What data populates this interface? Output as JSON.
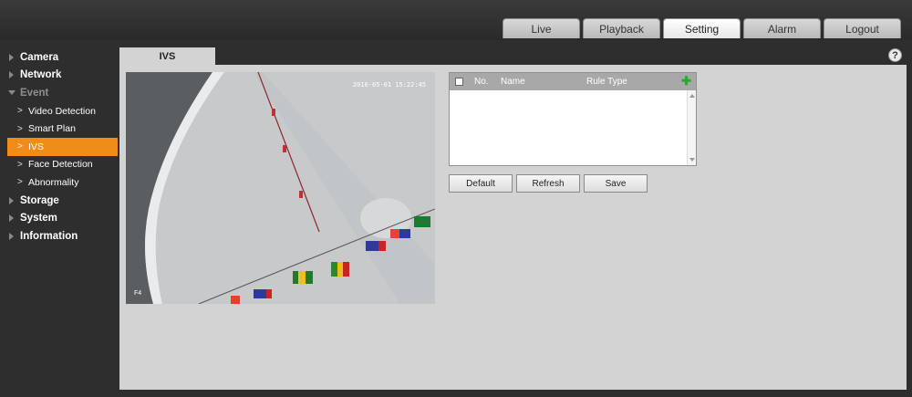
{
  "nav": {
    "tabs": [
      {
        "label": "Live",
        "active": false
      },
      {
        "label": "Playback",
        "active": false
      },
      {
        "label": "Setting",
        "active": true
      },
      {
        "label": "Alarm",
        "active": false
      },
      {
        "label": "Logout",
        "active": false
      }
    ]
  },
  "sidebar": {
    "items": [
      {
        "label": "Camera",
        "level": "top",
        "expanded": false
      },
      {
        "label": "Network",
        "level": "top",
        "expanded": false
      },
      {
        "label": "Event",
        "level": "top",
        "expanded": true
      },
      {
        "label": "Video Detection",
        "level": "sub"
      },
      {
        "label": "Smart Plan",
        "level": "sub"
      },
      {
        "label": "IVS",
        "level": "sub",
        "selected": true
      },
      {
        "label": "Face Detection",
        "level": "sub"
      },
      {
        "label": "Abnormality",
        "level": "sub"
      },
      {
        "label": "Storage",
        "level": "top",
        "expanded": false
      },
      {
        "label": "System",
        "level": "top",
        "expanded": false
      },
      {
        "label": "Information",
        "level": "top",
        "expanded": false
      }
    ]
  },
  "page": {
    "tab_label": "IVS",
    "help_icon": "?"
  },
  "video": {
    "timestamp": "2016-05-01 15:22:45",
    "channel_label": "F4"
  },
  "rule_table": {
    "headers": {
      "no": "No.",
      "name": "Name",
      "rule_type": "Rule Type"
    },
    "add_icon": "✚",
    "rows": []
  },
  "buttons": {
    "default": "Default",
    "refresh": "Refresh",
    "save": "Save"
  },
  "colors": {
    "accent_selected": "#f08c1a",
    "add_icon": "#27a832"
  }
}
